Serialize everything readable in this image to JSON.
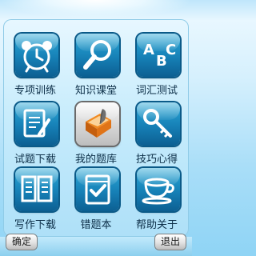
{
  "menu": {
    "items": [
      {
        "label": "专项训练",
        "icon": "alarm-clock-icon"
      },
      {
        "label": "知识课堂",
        "icon": "magnifier-icon"
      },
      {
        "label": "词汇测试",
        "icon": "abc-letters-icon"
      },
      {
        "label": "试题下载",
        "icon": "document-pen-icon"
      },
      {
        "label": "我的题库",
        "icon": "book-quill-icon",
        "selected": true
      },
      {
        "label": "技巧心得",
        "icon": "key-icon"
      },
      {
        "label": "写作下载",
        "icon": "open-book-icon"
      },
      {
        "label": "错题本",
        "icon": "checklist-notebook-icon"
      },
      {
        "label": "帮助关于",
        "icon": "coffee-cup-icon"
      }
    ]
  },
  "softkeys": {
    "left_label": "确定",
    "right_label": "退出"
  },
  "colors": {
    "tile_blue": "#1680b6",
    "tile_selected": "#d9d9d9",
    "background": "#bfe6fb"
  }
}
